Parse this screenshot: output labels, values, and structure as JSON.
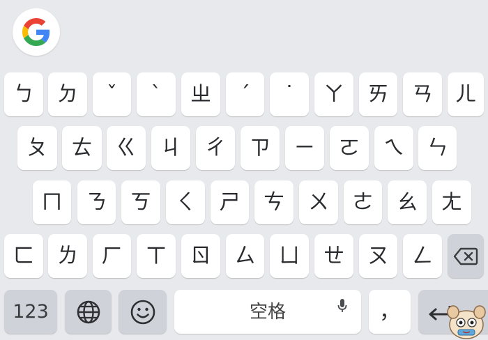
{
  "toolbar": {
    "google_icon": "google-g-logo"
  },
  "rows": [
    [
      "ㄅ",
      "ㄉ",
      "ˇ",
      "ˋ",
      "ㄓ",
      "ˊ",
      "˙",
      "ㄚ",
      "ㄞ",
      "ㄢ",
      "ㄦ"
    ],
    [
      "ㄆ",
      "ㄊ",
      "ㄍ",
      "ㄐ",
      "ㄔ",
      "ㄗ",
      "ㄧ",
      "ㄛ",
      "ㄟ",
      "ㄣ"
    ],
    [
      "ㄇ",
      "ㄋ",
      "ㄎ",
      "ㄑ",
      "ㄕ",
      "ㄘ",
      "ㄨ",
      "ㄜ",
      "ㄠ",
      "ㄤ"
    ],
    [
      "ㄈ",
      "ㄌ",
      "ㄏ",
      "ㄒ",
      "ㄖ",
      "ㄙ",
      "ㄩ",
      "ㄝ",
      "ㄡ",
      "ㄥ"
    ]
  ],
  "bottom": {
    "numbers_label": "123",
    "globe_icon": "globe-icon",
    "emoji_icon": "emoji-icon",
    "space_label": "空格",
    "mic_icon": "microphone-icon",
    "comma_label": "，",
    "enter_icon": "enter-arrow-icon",
    "backspace_icon": "backspace-icon"
  },
  "colors": {
    "background": "#e8e9ec",
    "key": "#ffffff",
    "function_key": "#cfd2d8",
    "text": "#2a2b2e"
  }
}
